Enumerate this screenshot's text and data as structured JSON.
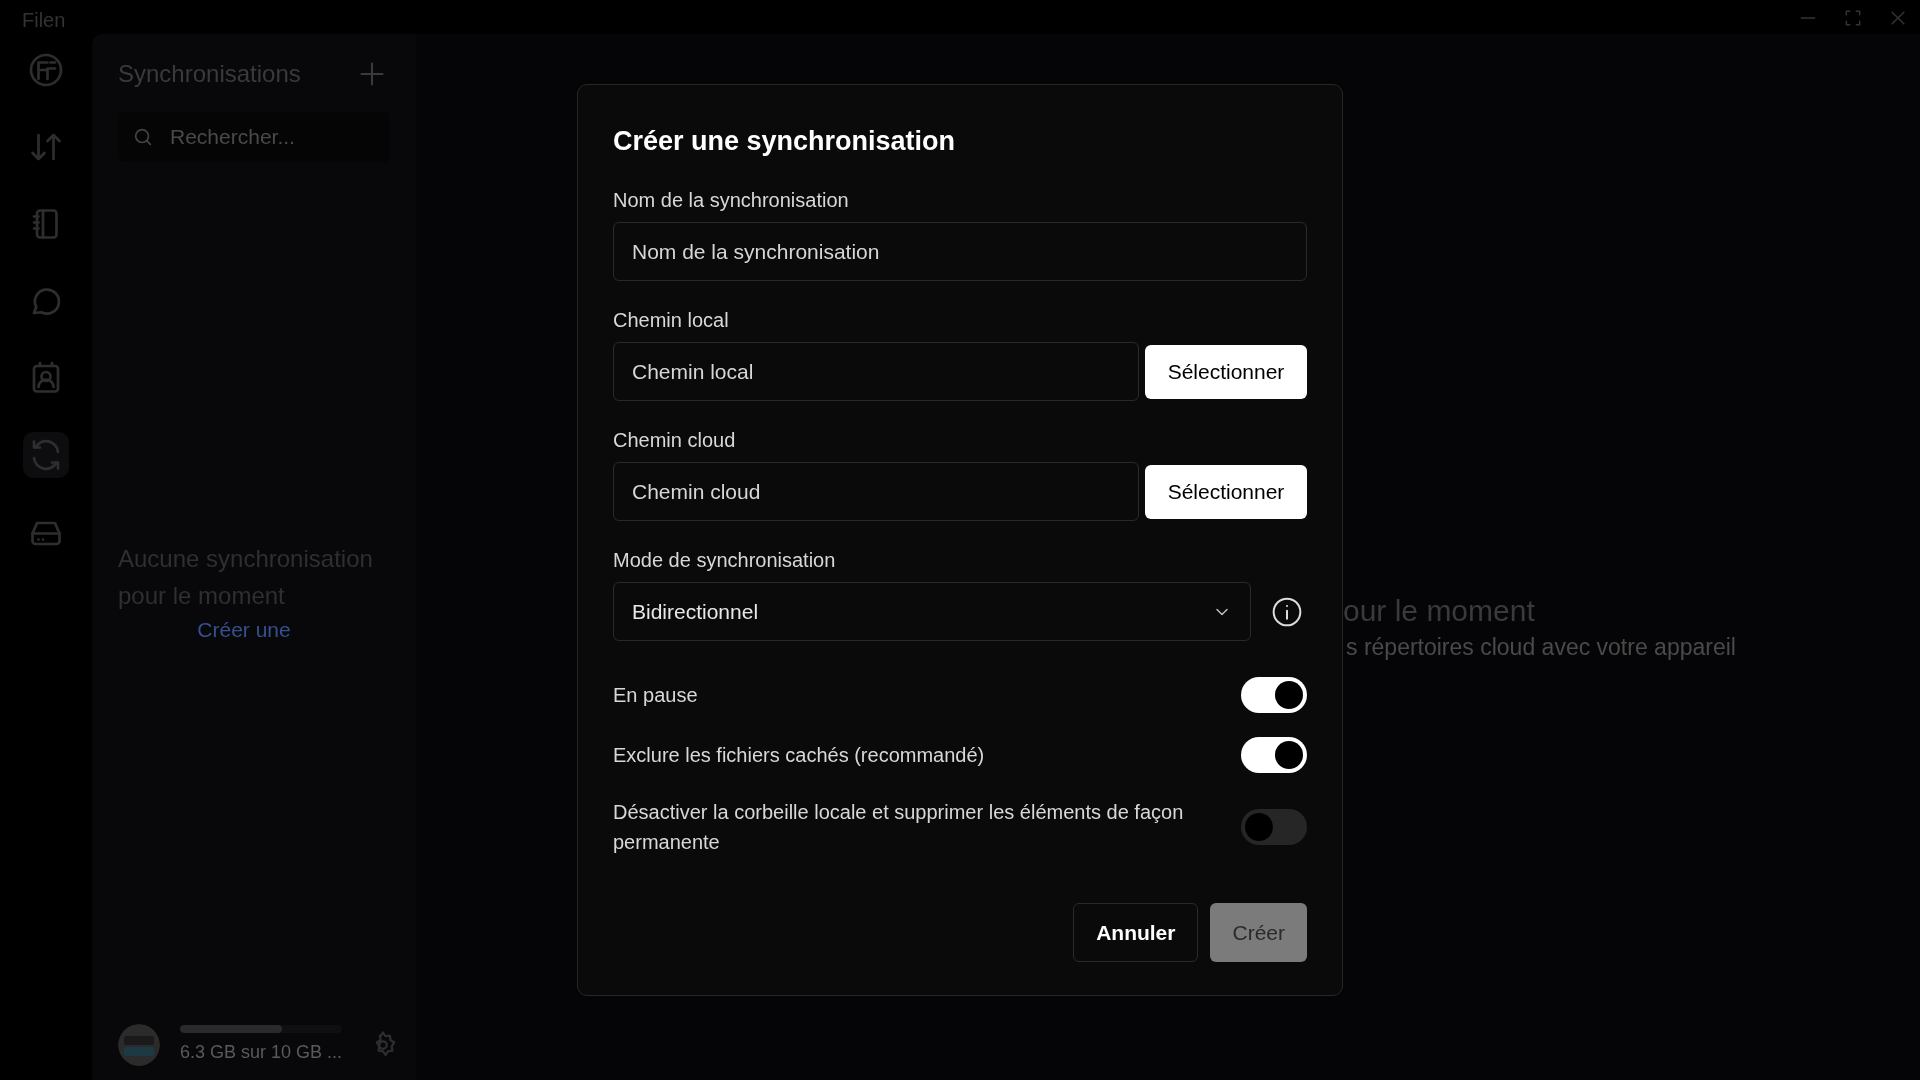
{
  "window": {
    "title": "Filen"
  },
  "rail": [
    {
      "selected": false
    },
    {
      "selected": false
    },
    {
      "selected": false
    },
    {
      "selected": false
    },
    {
      "selected": false
    },
    {
      "selected": true
    },
    {
      "selected": false
    }
  ],
  "sidebar": {
    "title": "Synchronisations",
    "search": {
      "placeholder": "Rechercher..."
    },
    "empty_text": "Aucune synchronisation pour le moment",
    "create_link": "Créer une",
    "storage": {
      "level": 0.63,
      "text": "6.3 GB sur 10 GB ..."
    }
  },
  "main": {
    "heading_fragment": "our le moment",
    "subtitle_fragment": "s répertoires cloud avec votre appareil"
  },
  "dialog": {
    "title": "Créer une synchronisation",
    "fields": [
      {
        "kind": "text",
        "label": "Nom de la synchronisation",
        "placeholder": "Nom de la synchronisation"
      },
      {
        "kind": "path",
        "label": "Chemin local",
        "placeholder": "Chemin local",
        "button": "Sélectionner"
      },
      {
        "kind": "path",
        "label": "Chemin cloud",
        "placeholder": "Chemin cloud",
        "button": "Sélectionner"
      },
      {
        "kind": "select",
        "label": "Mode de synchronisation",
        "value": "Bidirectionnel"
      }
    ],
    "toggles": [
      {
        "label": "En pause",
        "on": true
      },
      {
        "label": "Exclure les fichiers cachés (recommandé)",
        "on": true
      },
      {
        "label": "Désactiver la corbeille locale et supprimer les éléments de façon permanente",
        "on": false
      }
    ],
    "buttons": [
      {
        "label": "Annuler",
        "kind": "secondary",
        "disabled": false
      },
      {
        "label": "Créer",
        "kind": "primary",
        "disabled": true
      }
    ]
  }
}
